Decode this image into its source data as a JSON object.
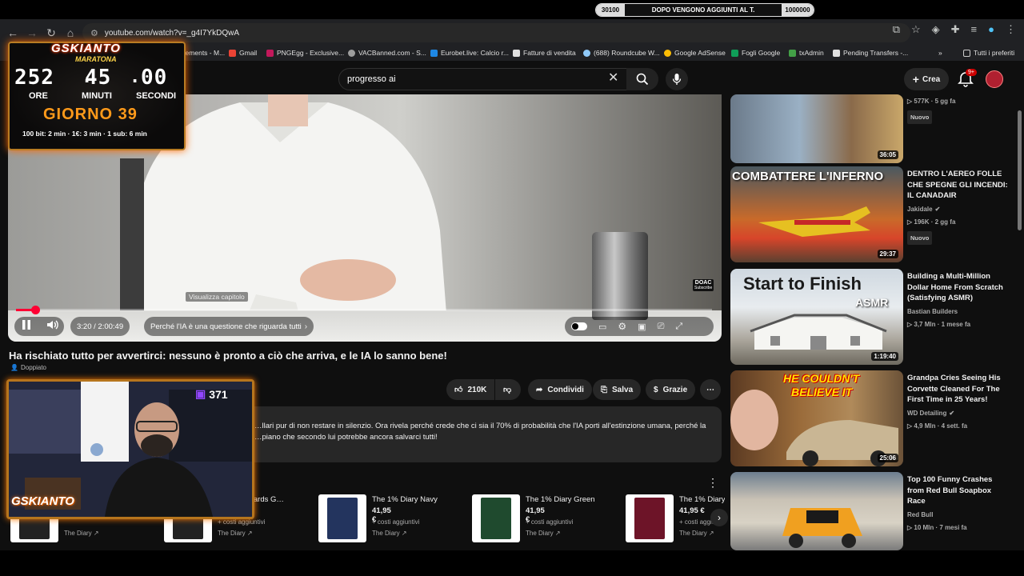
{
  "ticker": {
    "left": "30100",
    "message": "DOPO VENGONO AGGIUNTI AL T.",
    "right": "1000000"
  },
  "browser": {
    "url": "youtube.com/watch?v=_g4I7YkDQwA",
    "bookmarks": [
      {
        "label": "Gmail",
        "color": "#ea4335"
      },
      {
        "label": "PNGEgg - Exclusive...",
        "color": "#c2185b"
      },
      {
        "label": "VACBanned.com - S...",
        "color": "#9e9e9e"
      },
      {
        "label": "Eurobet.live: Calcio r...",
        "color": "#1e88e5"
      },
      {
        "label": "Fatture di vendita",
        "color": "#e0e0e0"
      },
      {
        "label": "(688) Roundcube W...",
        "color": "#90caf9"
      },
      {
        "label": "Google AdSense",
        "color": "#fbbc04"
      },
      {
        "label": "Fogli Google",
        "color": "#0f9d58"
      },
      {
        "label": "txAdmin",
        "color": "#43a047"
      },
      {
        "label": "Pending Transfers -...",
        "color": "#e0e0e0"
      }
    ],
    "bookmark_partial": "Elements - M...",
    "all_bookmarks": "Tutti i preferiti"
  },
  "youtube": {
    "search_value": "progresso ai",
    "create_label": "Crea",
    "notif_badge": "9+"
  },
  "player": {
    "chapter_tooltip": "Visualizza capitolo",
    "time": "3:20 / 2:00:49",
    "chapter": "Perché l'IA è una questione che riguarda tutti",
    "progress": 0.028,
    "doac": "DOAC",
    "doac_sub": "Subscribe"
  },
  "video": {
    "title": "Ha rischiato tutto per avvertirci: nessuno è pronto a ciò che arriva, e le IA lo sanno bene!",
    "dubbed": "Doppiato",
    "likes": "210K",
    "share": "Condividi",
    "save": "Salva",
    "thanks": "Grazie",
    "description_line1": "…llari pur di non restare in silenzio. Ora rivela perché crede che ci sia il 70% di probabilità che l'IA porti all'estinzione umana, perché la",
    "description_line2": "…piano che secondo lui potrebbe ancora salvarci tutti!"
  },
  "products": [
    {
      "name": "…uation Cards G…",
      "price": "",
      "extra": "+ costi aggiuntivi",
      "shop": "The Diary",
      "color": "#222222"
    },
    {
      "name": "The 1% Diary Navy",
      "price": "41,95 €",
      "extra": "+ costi aggiuntivi",
      "shop": "The Diary",
      "color": "#23345e"
    },
    {
      "name": "The 1% Diary Green",
      "price": "41,95 €",
      "extra": "+ costi aggiuntivi",
      "shop": "The Diary",
      "color": "#1f4a2e"
    },
    {
      "name": "The 1% Diary",
      "price": "41,95 €",
      "extra": "+ costi aggiuntivi",
      "shop": "The Diary",
      "color": "#6d1428"
    }
  ],
  "first_product_shop": "The Diary",
  "recommendations": [
    {
      "title": "",
      "channel": "",
      "views": "577K",
      "age": "5 gg fa",
      "badge": "Nuovo",
      "duration": "36:05",
      "thumb_text": ""
    },
    {
      "title": "DENTRO L'AEREO FOLLE CHE SPEGNE GLI INCENDI: IL CANADAIR",
      "channel": "Jakidale",
      "views": "196K",
      "age": "2 gg fa",
      "badge": "Nuovo",
      "duration": "29:37",
      "thumb_text": "COMBATTERE L'INFERNO"
    },
    {
      "title": "Building a Multi-Million Dollar Home From Scratch (Satisfying ASMR)",
      "channel": "Bastian Builders",
      "views": "3,7 Mln",
      "age": "1 mese fa",
      "badge": "",
      "duration": "1:19:40",
      "thumb_text": "Start to Finish",
      "thumb_text2": "ASMR"
    },
    {
      "title": "Grandpa Cries Seeing His Corvette Cleaned For The First Time in 25 Years!",
      "channel": "WD Detailing",
      "views": "4,9 Mln",
      "age": "4 sett. fa",
      "badge": "",
      "duration": "25:06",
      "thumb_text": "HE COULDN'T",
      "thumb_text2": "BELIEVE IT"
    },
    {
      "title": "Top 100 Funny Crashes from Red Bull Soapbox Race",
      "channel": "Red Bull",
      "views": "10 Mln",
      "age": "7 mesi fa",
      "badge": "",
      "duration": "",
      "thumb_text": ""
    }
  ],
  "overlay": {
    "brand": "GSKIANTO",
    "subtitle": "MARATONA",
    "hours": "252",
    "minutes": "45",
    "seconds": "00",
    "hours_label": "ORE",
    "minutes_label": "MINUTI",
    "seconds_label": "SECONDI",
    "day": "GIORNO 39",
    "rates": "100 bit: 2 min · 1€: 3 min · 1 sub: 6 min",
    "viewers": "371",
    "logo": "GSKIANTO"
  },
  "colors": {
    "accent": "#ff0033",
    "overlay_border": "#b97c23",
    "overlay_glow": "#ff6a00",
    "background": "#0f0f0f"
  }
}
